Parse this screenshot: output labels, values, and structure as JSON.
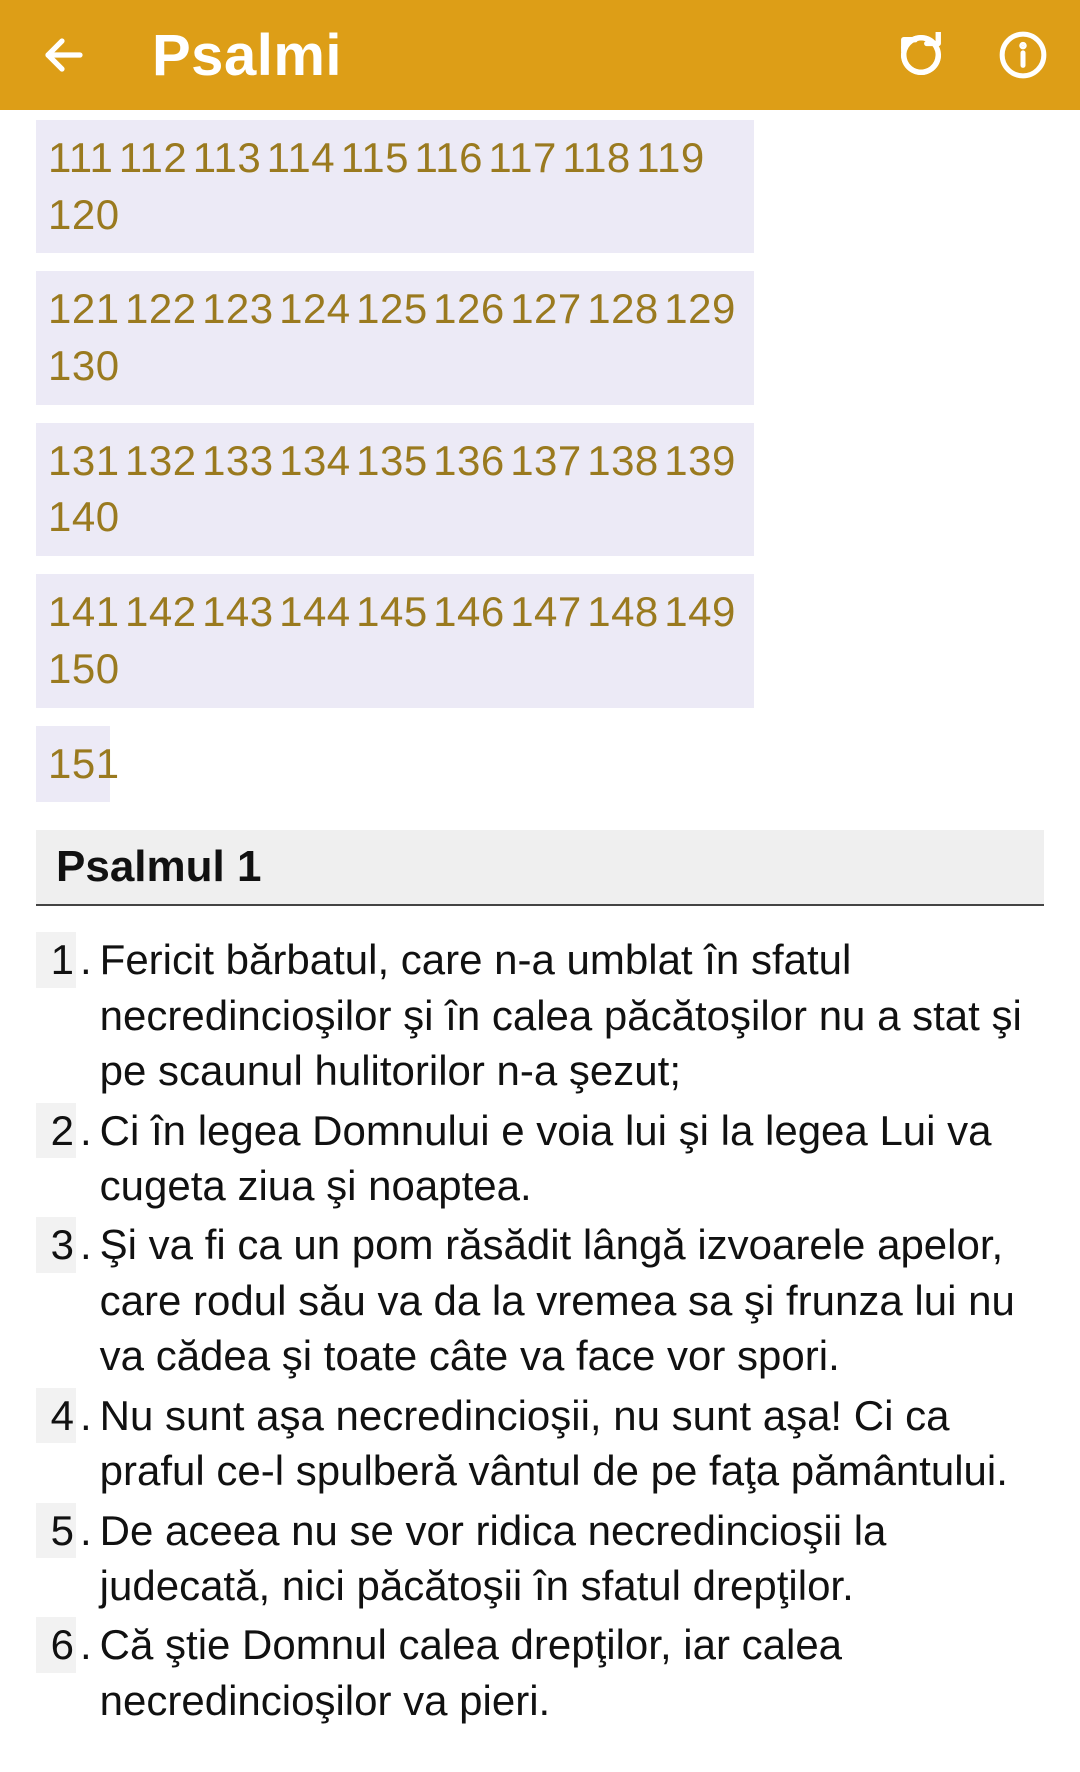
{
  "header": {
    "title": "Psalmi"
  },
  "nav": {
    "rows": [
      [
        "111",
        "112",
        "113",
        "114",
        "115",
        "116",
        "117",
        "118",
        "119",
        "120"
      ],
      [
        "121",
        "122",
        "123",
        "124",
        "125",
        "126",
        "127",
        "128",
        "129",
        "130"
      ],
      [
        "131",
        "132",
        "133",
        "134",
        "135",
        "136",
        "137",
        "138",
        "139",
        "140"
      ],
      [
        "141",
        "142",
        "143",
        "144",
        "145",
        "146",
        "147",
        "148",
        "149",
        "150"
      ],
      [
        "151"
      ]
    ]
  },
  "section": {
    "title": "Psalmul 1"
  },
  "verses": [
    {
      "n": "1",
      "t": "Fericit bărbatul, care n-a umblat în sfatul necredincioşilor şi în calea păcătoşilor nu a stat şi pe scaunul hulitorilor n-a şezut;"
    },
    {
      "n": "2",
      "t": "Ci în legea Domnului e voia lui şi la legea Lui va cugeta ziua şi noaptea."
    },
    {
      "n": "3",
      "t": "Şi va fi ca un pom răsădit lângă izvoarele apelor, care rodul său va da la vremea sa şi frunza lui nu va cădea şi toate câte va face vor spori."
    },
    {
      "n": "4",
      "t": "Nu sunt aşa necredincioşii, nu sunt aşa! Ci ca praful ce-l spulberă vântul de pe faţa pământului."
    },
    {
      "n": "5",
      "t": "De aceea nu se vor ridica necredincioşii la judecată, nici păcătoşii în sfatul drepţilor."
    },
    {
      "n": "6",
      "t": "Că ştie Domnul calea drepţilor, iar calea necredincioşilor va pieri."
    }
  ]
}
